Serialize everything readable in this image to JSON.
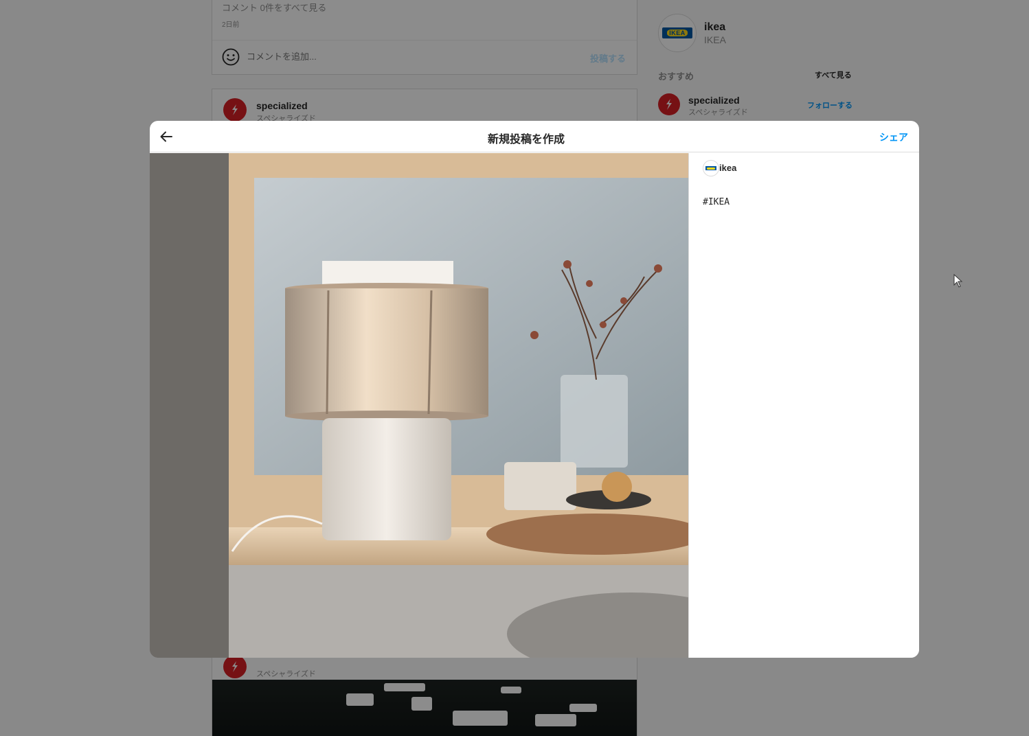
{
  "feed": {
    "top_post": {
      "view_comments": "コメント 0件をすべて見る",
      "time_ago": "2日前",
      "comment_placeholder": "コメントを追加...",
      "post_button": "投稿する"
    },
    "second_post": {
      "username": "specialized",
      "subtitle": "スペシャライズド"
    },
    "third_post": {
      "subtitle": "スペシャライズド"
    }
  },
  "sidebar": {
    "username": "ikea",
    "fullname": "IKEA",
    "suggestions_label": "おすすめ",
    "see_all": "すべて見る",
    "suggestion": {
      "username": "specialized",
      "subtitle": "スペシャライズド",
      "follow": "フォローする"
    }
  },
  "modal": {
    "title": "新規投稿を作成",
    "share": "シェア",
    "username": "ikea",
    "caption": "#IKEA"
  },
  "colors": {
    "accent": "#0095f6",
    "accent_disabled": "#b2dffc",
    "specialized_red": "#d71f26",
    "ikea_blue": "#0058a3",
    "ikea_yellow": "#ffda1a"
  }
}
